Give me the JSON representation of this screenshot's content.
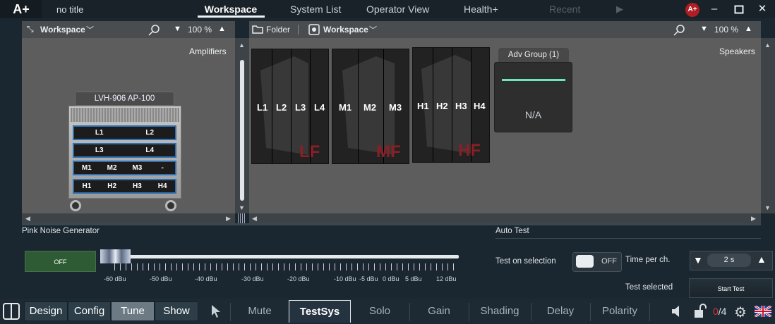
{
  "app": {
    "logo": "A+",
    "doc_title": "no title",
    "user_badge": "A+"
  },
  "nav_tabs": [
    {
      "label": "Workspace",
      "active": true
    },
    {
      "label": "System List"
    },
    {
      "label": "Operator View"
    },
    {
      "label": "Health+"
    },
    {
      "label": "Recent",
      "disabled": true
    }
  ],
  "left_panel": {
    "workspace_label": "Workspace",
    "zoom": "100 %",
    "title": "Amplifiers",
    "rack": {
      "name": "LVH-906 AP-100",
      "rows": [
        [
          "L1",
          "L2"
        ],
        [
          "L3",
          "L4"
        ],
        [
          "M1",
          "M2",
          "M3",
          "-"
        ],
        [
          "H1",
          "H2",
          "H3",
          "H4"
        ]
      ]
    }
  },
  "right_panel": {
    "folder_label": "Folder",
    "workspace_label": "Workspace",
    "zoom": "100 %",
    "title": "Speakers",
    "groups": [
      {
        "labels": [
          "L1",
          "L2",
          "L3",
          "L4"
        ],
        "tag": "LF"
      },
      {
        "labels": [
          "M1",
          "M2",
          "M3"
        ],
        "tag": "MF"
      },
      {
        "labels": [
          "H1",
          "H2",
          "H3",
          "H4"
        ],
        "tag": "HF"
      }
    ],
    "adv_group": {
      "title": "Adv Group (1)",
      "value": "N/A"
    }
  },
  "pink_noise": {
    "title": "Pink Noise Generator",
    "button": "OFF",
    "scale": [
      "-60 dBu",
      "-50 dBu",
      "-40 dBu",
      "-30 dBu",
      "-20 dBu",
      "-10 dBu",
      "-5 dBu",
      "0 dBu",
      "5 dBu",
      "12 dBu"
    ]
  },
  "auto_test": {
    "title": "Auto Test",
    "test_on_selection": "Test on selection",
    "toggle_state": "OFF",
    "time_per_ch_label": "Time per ch.",
    "time_value": "2 s",
    "test_selected": "Test selected",
    "start_button": "Start Test"
  },
  "modes": [
    {
      "label": "Design"
    },
    {
      "label": "Config"
    },
    {
      "label": "Tune",
      "active": true
    },
    {
      "label": "Show"
    }
  ],
  "tools": [
    {
      "label": "Mute"
    },
    {
      "label": "TestSys",
      "active": true
    },
    {
      "label": "Solo"
    },
    {
      "label": "Gain"
    },
    {
      "label": "Shading"
    },
    {
      "label": "Delay"
    },
    {
      "label": "Polarity"
    }
  ],
  "status": {
    "counter_current": "0",
    "counter_total": "/4"
  },
  "colors": {
    "accent_green": "#6fe4c1",
    "alert_red": "#b01e24",
    "speaker_tag": "#8a1f26"
  }
}
